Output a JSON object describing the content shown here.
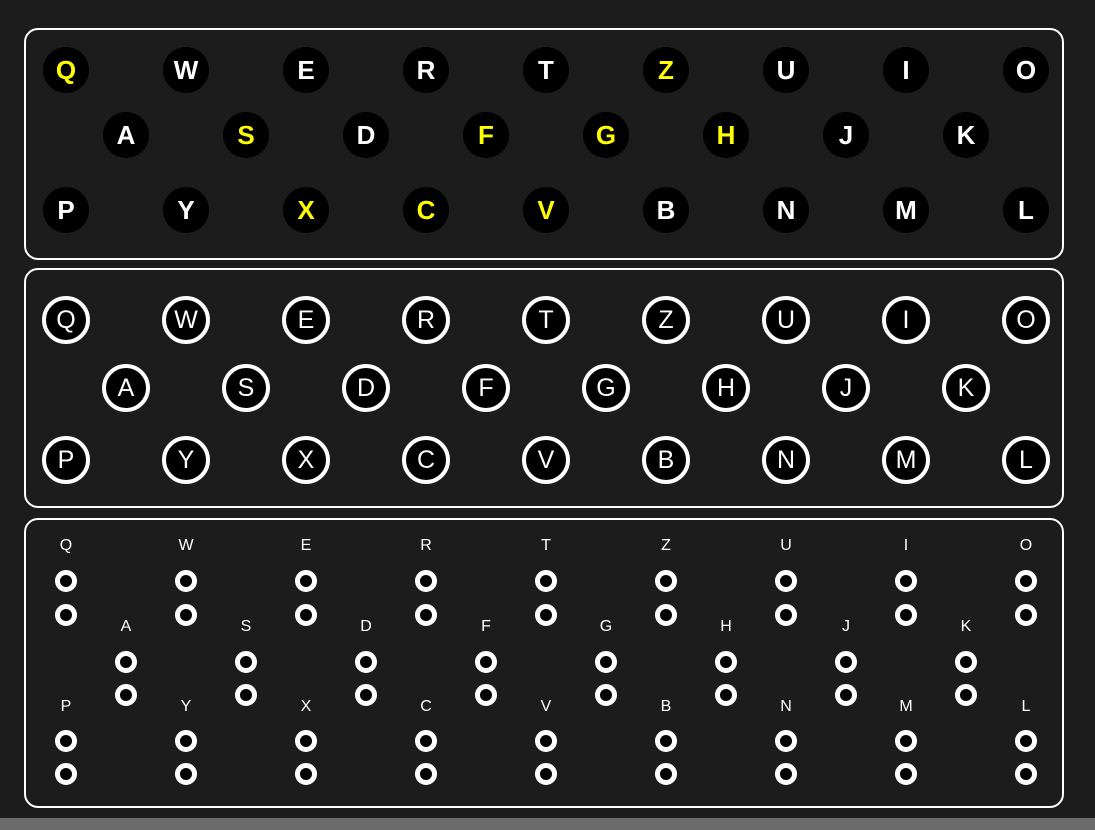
{
  "lampboard": {
    "rows": [
      [
        "Q",
        "W",
        "E",
        "R",
        "T",
        "Z",
        "U",
        "I",
        "O"
      ],
      [
        "A",
        "S",
        "D",
        "F",
        "G",
        "H",
        "J",
        "K"
      ],
      [
        "P",
        "Y",
        "X",
        "C",
        "V",
        "B",
        "N",
        "M",
        "L"
      ]
    ],
    "lit": [
      "Q",
      "Z",
      "S",
      "F",
      "G",
      "H",
      "X",
      "C",
      "V"
    ],
    "lit_color": "#ffff00",
    "unlit_color": "#ffffff"
  },
  "keyboard": {
    "rows": [
      [
        "Q",
        "W",
        "E",
        "R",
        "T",
        "Z",
        "U",
        "I",
        "O"
      ],
      [
        "A",
        "S",
        "D",
        "F",
        "G",
        "H",
        "J",
        "K"
      ],
      [
        "P",
        "Y",
        "X",
        "C",
        "V",
        "B",
        "N",
        "M",
        "L"
      ]
    ]
  },
  "plugboard": {
    "rows": [
      [
        "Q",
        "W",
        "E",
        "R",
        "T",
        "Z",
        "U",
        "I",
        "O"
      ],
      [
        "A",
        "S",
        "D",
        "F",
        "G",
        "H",
        "J",
        "K"
      ],
      [
        "P",
        "Y",
        "X",
        "C",
        "V",
        "B",
        "N",
        "M",
        "L"
      ]
    ]
  },
  "colors": {
    "background": "#1c1c1c",
    "border": "#ffffff",
    "bottom_bar": "#6b6b6b"
  }
}
